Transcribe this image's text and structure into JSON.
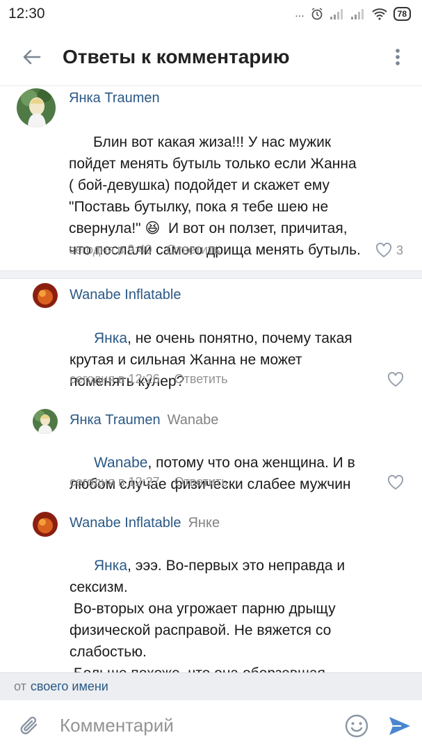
{
  "status_bar": {
    "time": "12:30",
    "dots": "...",
    "battery": "78"
  },
  "header": {
    "title": "Ответы к комментарию"
  },
  "comments": [
    {
      "author": "Янка Traumen",
      "reply_to": "",
      "mention": "",
      "text": "Блин вот какая жиза!!! У нас мужик\nпойдет менять бутыль только если Жанна\n( бой-девушка) подойдет и скажет ему\n\"Поставь бутылку, пока я тебе шею не\nсвернула!\" 😆  И вот он ползет, причитая,\nчто послали самого дрища менять бутыль.",
      "time": "сегодня в 9:40",
      "reply_label": "Ответить",
      "likes": "3"
    },
    {
      "author": "Wanabe Inflatable",
      "reply_to": "",
      "mention": "Янка",
      "text": ", не очень понятно, почему такая\nкрутая и сильная Жанна не может\nпоменять кулер?",
      "time": "сегодня в 12:26",
      "reply_label": "Ответить",
      "likes": ""
    },
    {
      "author": "Янка Traumen",
      "reply_to": "Wanabe",
      "mention": "Wanabe",
      "text": ", потому что она женщина. И в\nлюбом случае физически слабее мужчин",
      "time": "сегодня в 12:27",
      "reply_label": "Ответить",
      "likes": ""
    },
    {
      "author": "Wanabe Inflatable",
      "reply_to": "Янке",
      "mention": "Янка",
      "text": ", эээ. Во-первых это неправда и\nсексизм.\n Во-вторых она угрожает парню дрыщу\nфизической расправой. Не вяжется со\nслабостью.\n Больше похоже, что она оборзевшая\nяжедевочка",
      "time": "",
      "reply_label": "",
      "likes": ""
    }
  ],
  "from_bar": {
    "prefix": "от",
    "link": "своего имени"
  },
  "composer": {
    "placeholder": "Комментарий"
  },
  "colors": {
    "link": "#2a5885",
    "accent": "#4a76a8",
    "meta": "#939393"
  },
  "icons": [
    "back-arrow-icon",
    "more-vertical-icon",
    "heart-icon",
    "paperclip-icon",
    "smile-icon",
    "send-icon"
  ]
}
